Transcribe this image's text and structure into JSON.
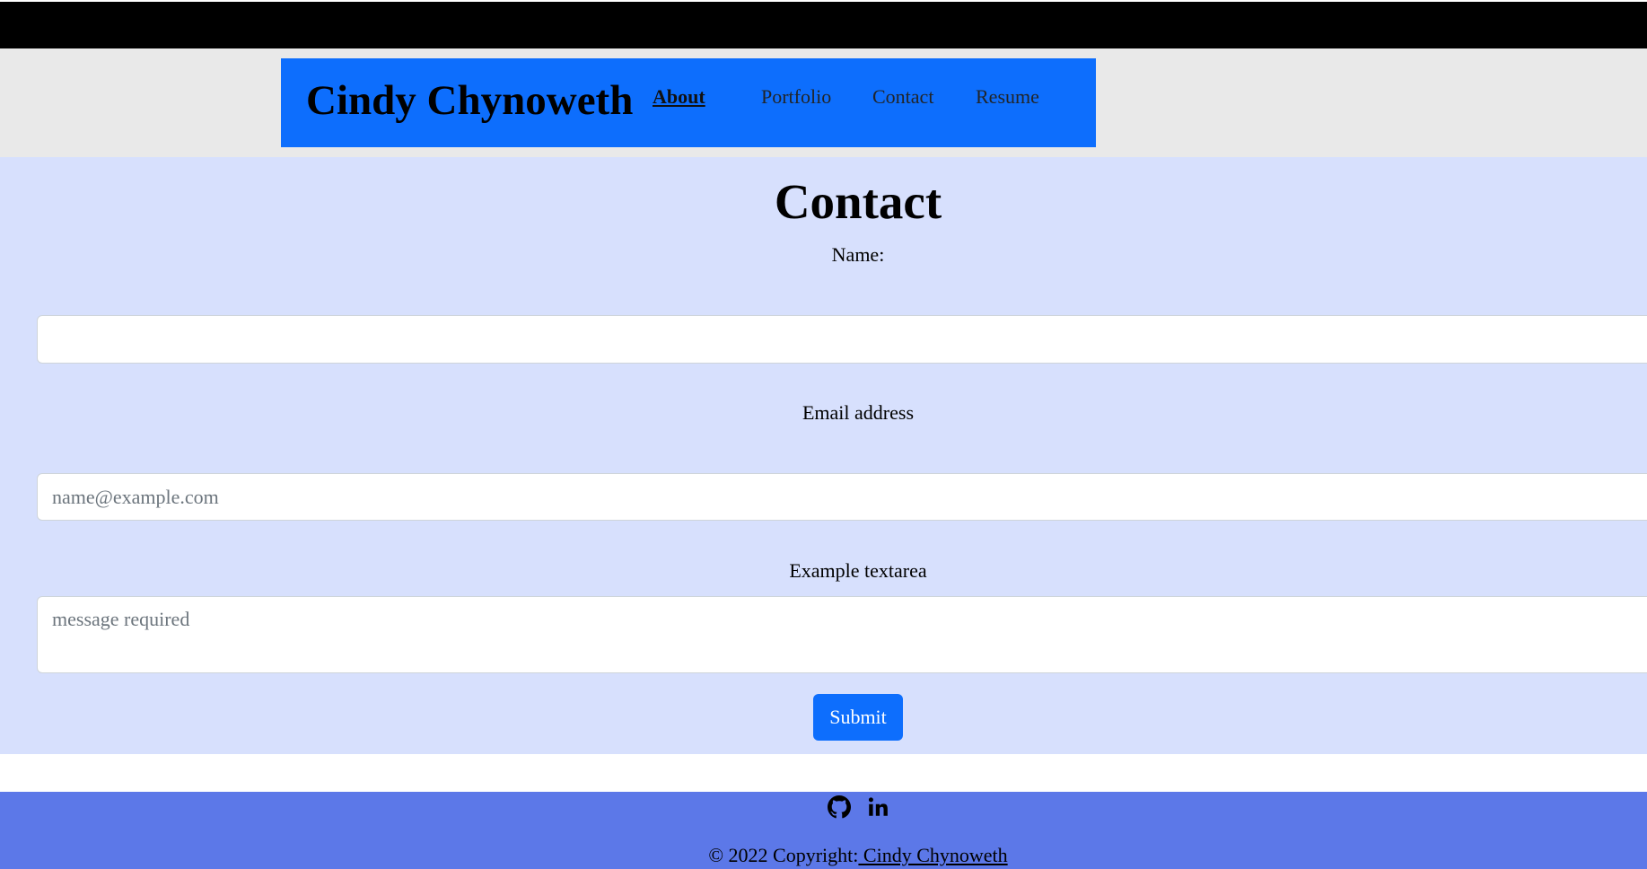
{
  "header": {
    "brand": "Cindy Chynoweth",
    "nav": [
      {
        "label": "About",
        "active": true
      },
      {
        "label": "Portfolio",
        "active": false
      },
      {
        "label": "Contact",
        "active": false
      },
      {
        "label": "Resume",
        "active": false
      }
    ]
  },
  "contact": {
    "title": "Contact",
    "name_label": "Name:",
    "name_value": "",
    "email_label": "Email address",
    "email_placeholder": "name@example.com",
    "message_label": "Example textarea",
    "message_placeholder": "message required",
    "submit_label": "Submit"
  },
  "footer": {
    "icons": [
      "github-icon",
      "linkedin-icon"
    ],
    "copyright_prefix": "© 2022 Copyright:",
    "copyright_link": " Cindy Chynoweth"
  },
  "colors": {
    "topbar": "#000000",
    "header_band": "#e9e9e9",
    "nav_background": "#0d6efd",
    "section_background": "#d7e0fd",
    "button": "#0d6efd",
    "footer": "#5c78e8"
  }
}
